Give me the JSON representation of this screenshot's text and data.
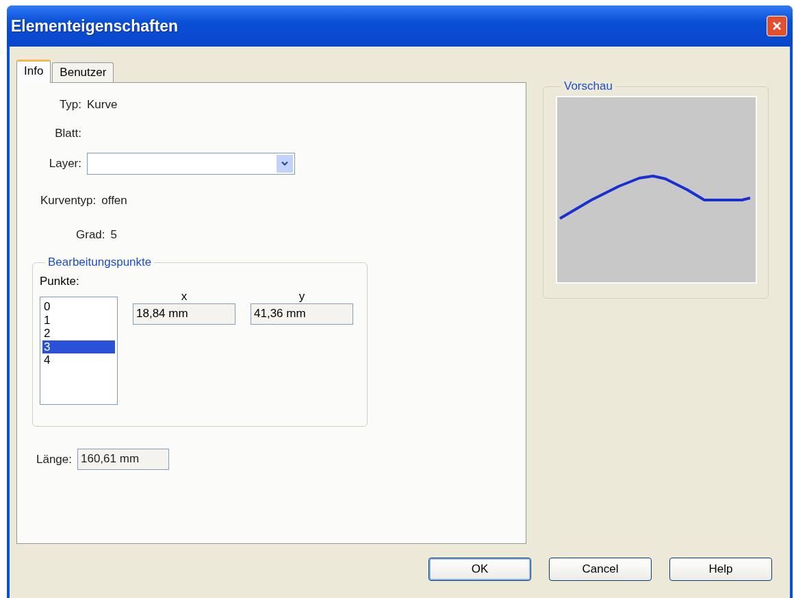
{
  "window": {
    "title": "Elementeigenschaften"
  },
  "tabs": [
    {
      "label": "Info",
      "selected": true
    },
    {
      "label": "Benutzer",
      "selected": false
    }
  ],
  "info": {
    "type": {
      "label": "Typ:",
      "value": "Kurve"
    },
    "sheet": {
      "label": "Blatt:"
    },
    "layer": {
      "label": "Layer:"
    },
    "curve_type": {
      "label": "Kurventyp:",
      "value": "offen"
    },
    "degree": {
      "label": "Grad:",
      "value": "5"
    }
  },
  "points_group": {
    "title": "Bearbeitungspunkte",
    "list_label": "Punkte:",
    "items": [
      {
        "label": "0",
        "selected": false
      },
      {
        "label": "1",
        "selected": false
      },
      {
        "label": "2",
        "selected": false
      },
      {
        "label": "3",
        "selected": true
      },
      {
        "label": "4",
        "selected": false
      }
    ],
    "x": {
      "label": "x",
      "value": "18,84 mm"
    },
    "y": {
      "label": "y",
      "value": "41,36 mm"
    }
  },
  "length": {
    "label": "Länge:",
    "value": "160,61 mm"
  },
  "preview": {
    "title": "Vorschau"
  },
  "buttons": [
    {
      "label": "OK",
      "default": true
    },
    {
      "label": "Cancel",
      "default": false
    },
    {
      "label": "Help",
      "default": false
    }
  ]
}
